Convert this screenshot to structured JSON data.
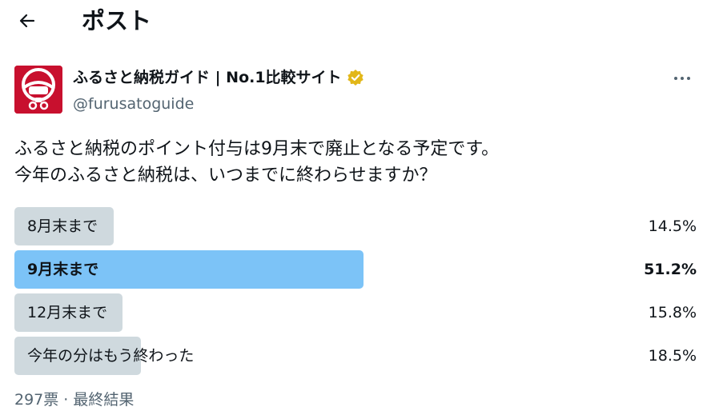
{
  "header": {
    "title": "ポスト",
    "back_icon": "arrow-left-icon"
  },
  "author": {
    "name": "ふるさと納税ガイド | No.1比較サイト",
    "handle": "@furusatoguide",
    "verified": true,
    "verified_color": "#e2b719",
    "avatar_color": "#c8102e"
  },
  "tweet": {
    "lines": [
      "ふるさと納税のポイント付与は9月末で廃止となる予定です。",
      "今年のふるさと納税は、いつまでに終わらせますか？"
    ]
  },
  "poll": {
    "options": [
      {
        "label": "8月末まで",
        "percent_text": "14.5%",
        "percent": 14.5,
        "winner": false
      },
      {
        "label": "9月末まで",
        "percent_text": "51.2%",
        "percent": 51.2,
        "winner": true
      },
      {
        "label": "12月末まで",
        "percent_text": "15.8%",
        "percent": 15.8,
        "winner": false
      },
      {
        "label": "今年の分はもう終わった",
        "percent_text": "18.5%",
        "percent": 18.5,
        "winner": false
      }
    ],
    "meta": "297票 · 最終結果",
    "bar_color": "#cfd9de",
    "winner_color": "#7cc3f7"
  }
}
